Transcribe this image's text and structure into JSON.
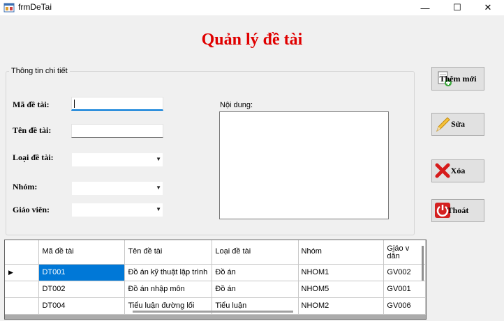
{
  "window": {
    "title": "frmDeTai",
    "minimize_glyph": "—",
    "maximize_glyph": "☐",
    "close_glyph": "✕"
  },
  "form": {
    "title": "Quản lý đề tài",
    "group_title": "Thông tin chi tiết",
    "labels": {
      "ma_de_tai": "Mã đề tài:",
      "ten_de_tai": "Tên đề tài:",
      "loai_de_tai": "Loại đề tài:",
      "nhom": "Nhóm:",
      "giao_vien": "Giáo viên:",
      "noi_dung": "Nội dung:"
    },
    "values": {
      "ma_de_tai": "",
      "ten_de_tai": "",
      "loai_de_tai": "",
      "nhom": "",
      "giao_vien": "",
      "noi_dung": ""
    }
  },
  "buttons": {
    "them_moi": "Thêm mới",
    "sua": "Sửa",
    "xoa": "Xóa",
    "thoat": "Thoát"
  },
  "grid": {
    "columns": [
      "Mã đề tài",
      "Tên đề tài",
      "Loại đề tài",
      "Nhóm",
      "Giáo viên hướng dẫn"
    ],
    "column_display": [
      "Mã đề tài",
      "Tên đề tài",
      "Loại đề tài",
      "Nhóm",
      "Giáo v\ndẫn"
    ],
    "rows": [
      [
        "DT001",
        "Đồ án kỹ thuật lập trình",
        "Đồ án",
        "NHOM1",
        "GV002"
      ],
      [
        "DT002",
        "Đồ án nhập môn",
        "Đồ án",
        "NHOM5",
        "GV001"
      ],
      [
        "DT004",
        "Tiểu luận đường lối",
        "Tiểu luận",
        "NHOM2",
        "GV006"
      ]
    ],
    "selected_row": 0
  },
  "icons": {
    "app": "form-app-icon",
    "add": "add-document-icon",
    "edit": "pencil-icon",
    "delete": "red-x-icon",
    "exit": "power-icon"
  },
  "colors": {
    "title": "#e00000",
    "selection": "#0078d7"
  }
}
